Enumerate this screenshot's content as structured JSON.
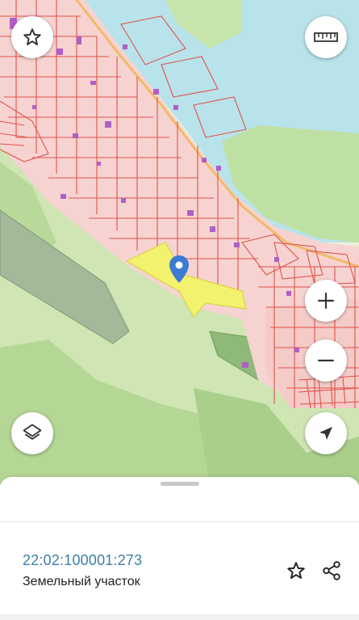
{
  "map": {
    "colors": {
      "water": "#b9e3ea",
      "forest_light": "#cfe6b4",
      "forest_dark": "#a9cf8a",
      "settlement": "#f6d3d0",
      "parcel_border": "#e0524c",
      "selected_parcel": "#f2f26e",
      "building": "#b05ec8",
      "road": "#f3b96a",
      "pin": "#3a7bd5"
    },
    "marker": {
      "icon": "location-pin-icon"
    }
  },
  "controls": {
    "favorite": {
      "icon": "star-icon"
    },
    "ruler": {
      "icon": "ruler-icon"
    },
    "zoom_in": {
      "icon": "plus-icon"
    },
    "zoom_out": {
      "icon": "minus-icon"
    },
    "layers": {
      "icon": "layers-icon"
    },
    "locate": {
      "icon": "navigation-arrow-icon"
    }
  },
  "sheet": {
    "cadastral_number": "22:02:100001:273",
    "object_type": "Земельный участок",
    "actions": [
      {
        "icon": "star-outline-icon"
      },
      {
        "icon": "share-icon"
      }
    ]
  }
}
